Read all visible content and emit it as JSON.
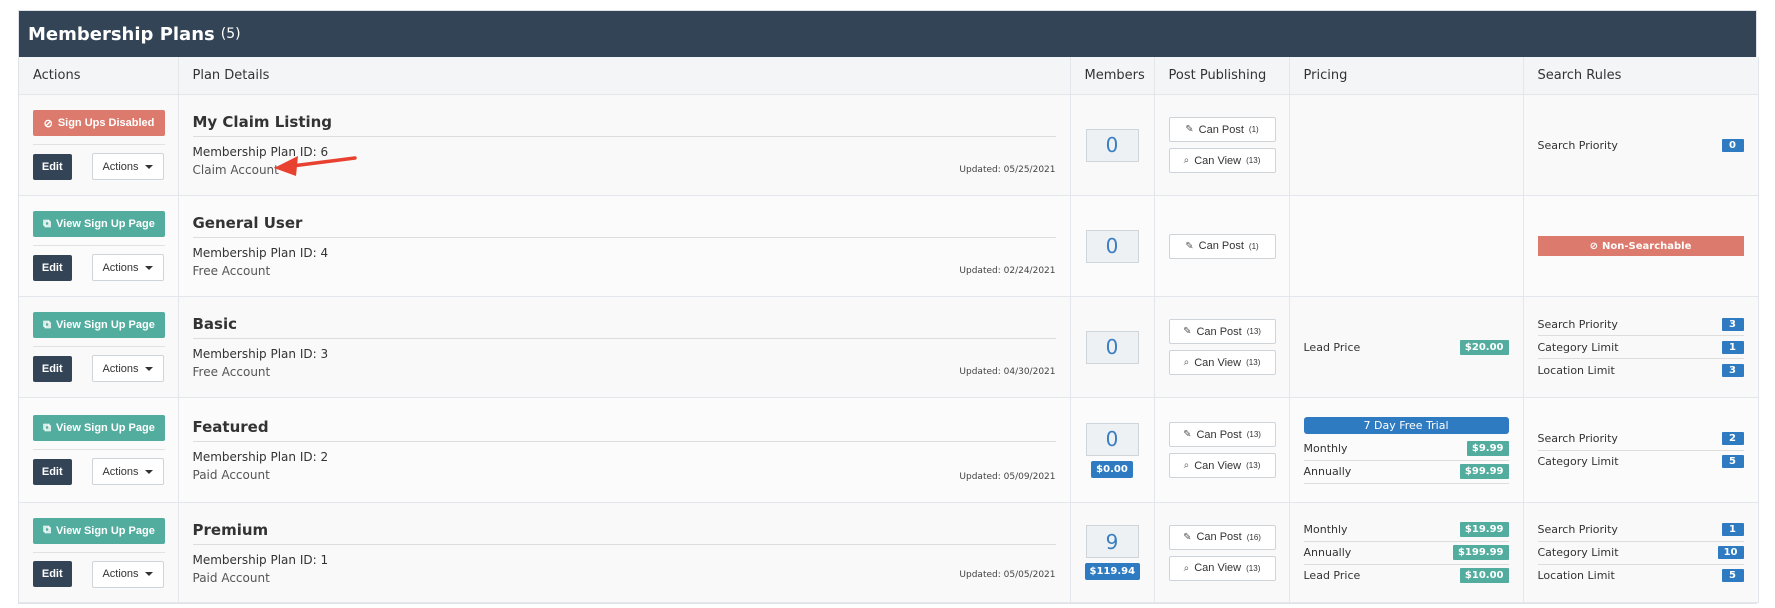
{
  "header": {
    "title": "Membership Plans",
    "count": "(5)"
  },
  "columns": {
    "actions": "Actions",
    "plan_details": "Plan Details",
    "members": "Members",
    "post_publishing": "Post Publishing",
    "pricing": "Pricing",
    "search_rules": "Search Rules"
  },
  "common": {
    "edit_label": "Edit",
    "actions_label": "Actions"
  },
  "plans": [
    {
      "status_button": "Sign Ups Disabled",
      "status_type": "disabled",
      "name": "My Claim Listing",
      "id_label": "Membership Plan ID:",
      "id_value": "6",
      "type": "Claim Account",
      "updated": "Updated: 05/25/2021",
      "members": "0",
      "members_total": "",
      "can_post": "Can Post",
      "can_post_count": "(1)",
      "can_view": "Can View",
      "can_view_count": "(13)",
      "pricing": [],
      "search_rules": [
        {
          "label": "Search Priority",
          "value": "0"
        }
      ]
    },
    {
      "status_button": "View Sign Up Page",
      "status_type": "view",
      "name": "General User",
      "id_label": "Membership Plan ID:",
      "id_value": "4",
      "type": "Free Account",
      "updated": "Updated: 02/24/2021",
      "members": "0",
      "members_total": "",
      "can_post": "Can Post",
      "can_post_count": "(1)",
      "pricing": [],
      "non_searchable": "Non-Searchable"
    },
    {
      "status_button": "View Sign Up Page",
      "status_type": "view",
      "name": "Basic",
      "id_label": "Membership Plan ID:",
      "id_value": "3",
      "type": "Free Account",
      "updated": "Updated: 04/30/2021",
      "members": "0",
      "members_total": "",
      "can_post": "Can Post",
      "can_post_count": "(13)",
      "can_view": "Can View",
      "can_view_count": "(13)",
      "pricing": [
        {
          "label": "Lead Price",
          "value": "$20.00"
        }
      ],
      "search_rules": [
        {
          "label": "Search Priority",
          "value": "3"
        },
        {
          "label": "Category Limit",
          "value": "1"
        },
        {
          "label": "Location Limit",
          "value": "3"
        }
      ]
    },
    {
      "status_button": "View Sign Up Page",
      "status_type": "view",
      "name": "Featured",
      "id_label": "Membership Plan ID:",
      "id_value": "2",
      "type": "Paid Account",
      "updated": "Updated: 05/09/2021",
      "members": "0",
      "members_total": "$0.00",
      "can_post": "Can Post",
      "can_post_count": "(13)",
      "can_view": "Can View",
      "can_view_count": "(13)",
      "trial": "7 Day Free Trial",
      "pricing": [
        {
          "label": "Monthly",
          "value": "$9.99"
        },
        {
          "label": "Annually",
          "value": "$99.99"
        }
      ],
      "search_rules": [
        {
          "label": "Search Priority",
          "value": "2"
        },
        {
          "label": "Category Limit",
          "value": "5"
        }
      ]
    },
    {
      "status_button": "View Sign Up Page",
      "status_type": "view",
      "name": "Premium",
      "id_label": "Membership Plan ID:",
      "id_value": "1",
      "type": "Paid Account",
      "updated": "Updated: 05/05/2021",
      "members": "9",
      "members_total": "$119.94",
      "can_post": "Can Post",
      "can_post_count": "(16)",
      "can_view": "Can View",
      "can_view_count": "(13)",
      "pricing": [
        {
          "label": "Monthly",
          "value": "$19.99"
        },
        {
          "label": "Annually",
          "value": "$199.99"
        },
        {
          "label": "Lead Price",
          "value": "$10.00"
        }
      ],
      "search_rules": [
        {
          "label": "Search Priority",
          "value": "1"
        },
        {
          "label": "Category Limit",
          "value": "10"
        },
        {
          "label": "Location Limit",
          "value": "5"
        }
      ]
    }
  ],
  "colors": {
    "header_bg": "#344457",
    "teal": "#52ad9f",
    "red": "#dc7b6d",
    "blue": "#2f7bc1",
    "arrow": "#e8412f"
  }
}
